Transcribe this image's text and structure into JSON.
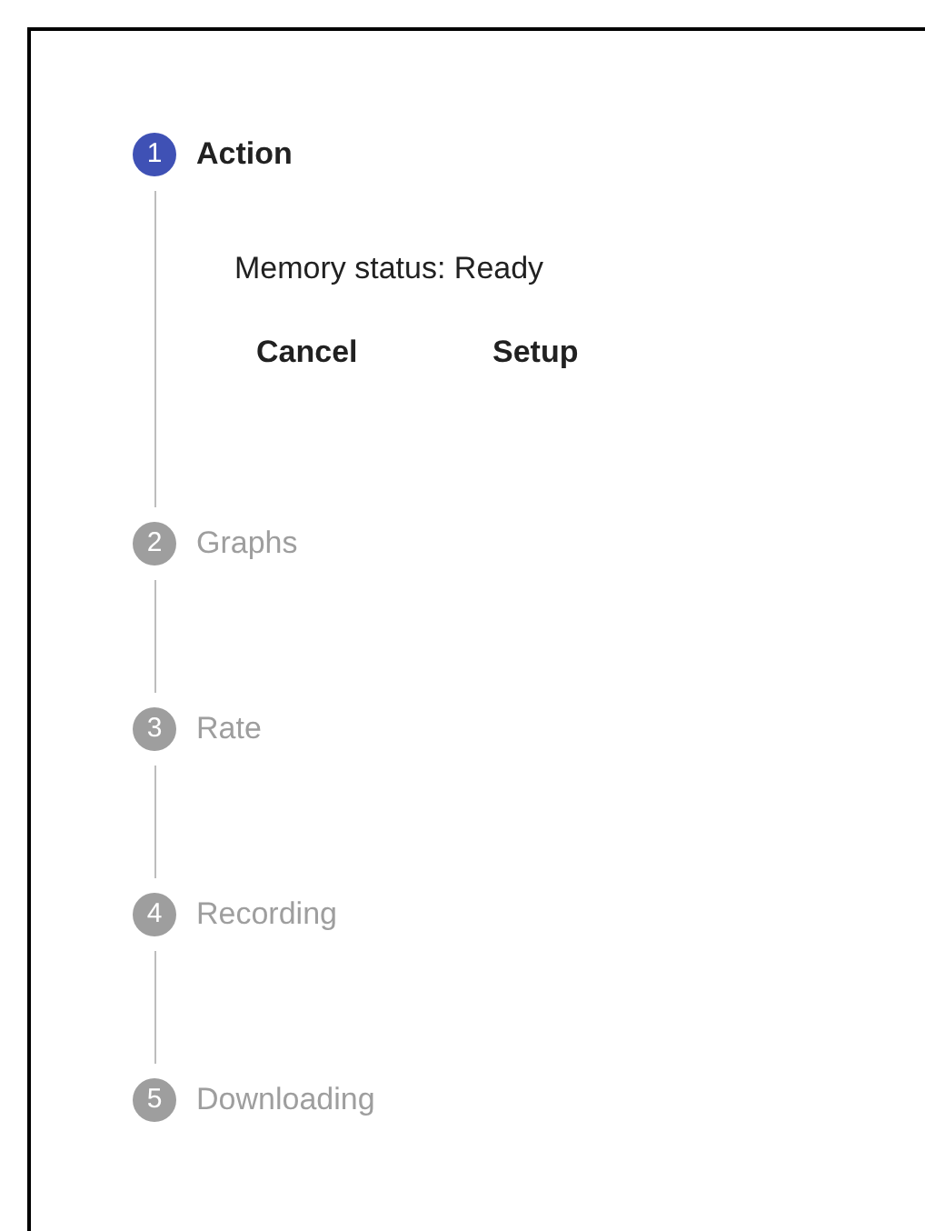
{
  "steps": [
    {
      "number": "1",
      "label": "Action",
      "selected": true
    },
    {
      "number": "2",
      "label": "Graphs",
      "selected": false
    },
    {
      "number": "3",
      "label": "Rate",
      "selected": false
    },
    {
      "number": "4",
      "label": "Recording",
      "selected": false
    },
    {
      "number": "5",
      "label": "Downloading",
      "selected": false
    }
  ],
  "content": {
    "status": "Memory status: Ready",
    "buttons": [
      "Cancel",
      "Setup"
    ]
  }
}
